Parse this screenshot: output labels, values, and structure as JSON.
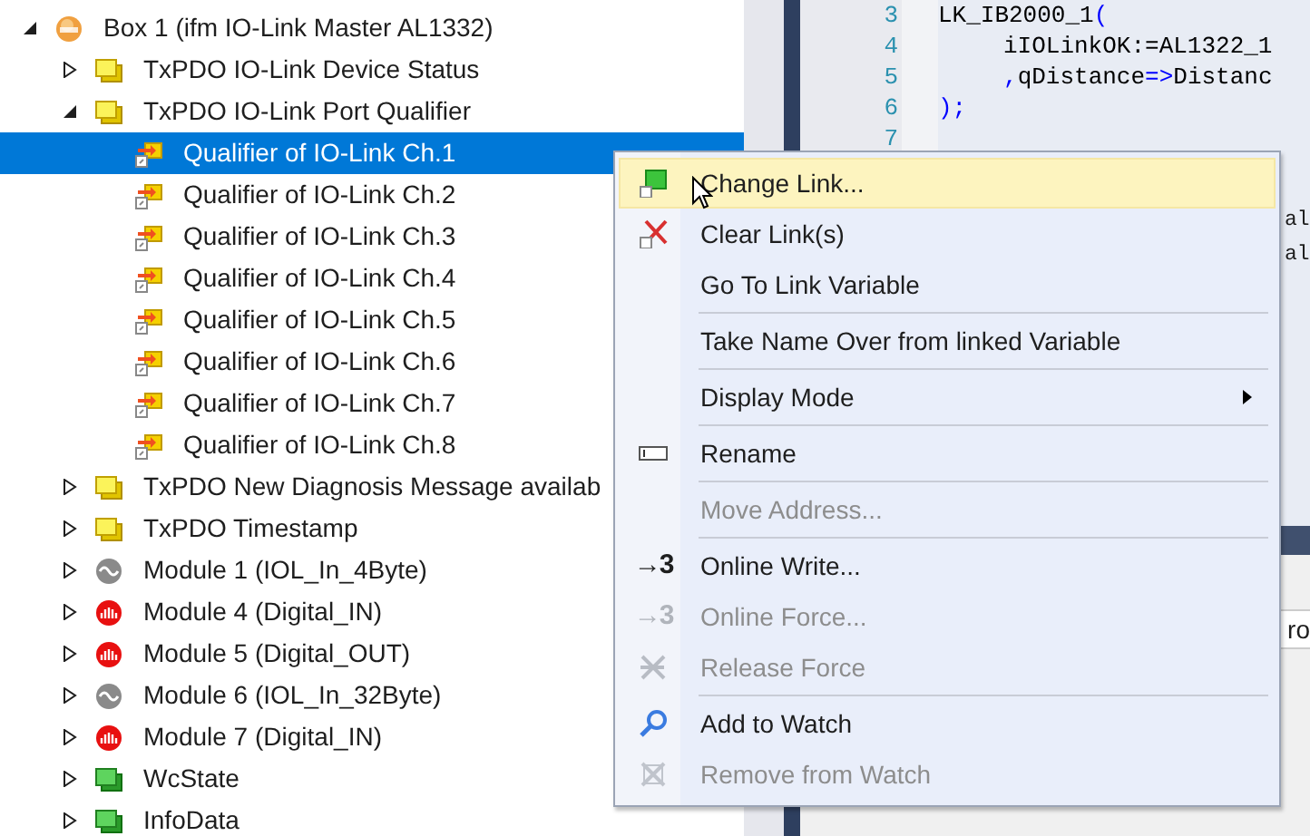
{
  "tree": [
    {
      "label": "Box 1 (ifm IO-Link Master AL1332)",
      "kind": "box",
      "expanded": true,
      "selected": false,
      "children": [
        {
          "label": "TxPDO IO-Link Device Status",
          "kind": "pdo",
          "expanded": false,
          "selected": false
        },
        {
          "label": "TxPDO IO-Link Port Qualifier",
          "kind": "pdo",
          "expanded": true,
          "selected": false,
          "children": [
            {
              "label": "Qualifier of IO-Link Ch.1",
              "kind": "variable",
              "selected": true
            },
            {
              "label": "Qualifier of IO-Link Ch.2",
              "kind": "variable",
              "selected": false
            },
            {
              "label": "Qualifier of IO-Link Ch.3",
              "kind": "variable",
              "selected": false
            },
            {
              "label": "Qualifier of IO-Link Ch.4",
              "kind": "variable",
              "selected": false
            },
            {
              "label": "Qualifier of IO-Link Ch.5",
              "kind": "variable",
              "selected": false
            },
            {
              "label": "Qualifier of IO-Link Ch.6",
              "kind": "variable",
              "selected": false
            },
            {
              "label": "Qualifier of IO-Link Ch.7",
              "kind": "variable",
              "selected": false
            },
            {
              "label": "Qualifier of IO-Link Ch.8",
              "kind": "variable",
              "selected": false
            }
          ]
        },
        {
          "label": "TxPDO New Diagnosis Message availab",
          "kind": "pdo",
          "expanded": false,
          "selected": false
        },
        {
          "label": "TxPDO Timestamp",
          "kind": "pdo",
          "expanded": false,
          "selected": false
        },
        {
          "label": "Module 1 (IOL_In_4Byte)",
          "kind": "module_iol",
          "expanded": false,
          "selected": false
        },
        {
          "label": "Module 4 (Digital_IN)",
          "kind": "module_digital",
          "expanded": false,
          "selected": false
        },
        {
          "label": "Module 5 (Digital_OUT)",
          "kind": "module_digital",
          "expanded": false,
          "selected": false
        },
        {
          "label": "Module 6 (IOL_In_32Byte)",
          "kind": "module_iol",
          "expanded": false,
          "selected": false
        },
        {
          "label": "Module 7 (Digital_IN)",
          "kind": "module_digital",
          "expanded": false,
          "selected": false
        },
        {
          "label": "WcState",
          "kind": "state",
          "expanded": false,
          "selected": false
        },
        {
          "label": "InfoData",
          "kind": "state",
          "expanded": false,
          "selected": false
        }
      ]
    }
  ],
  "editor": {
    "lines": [
      {
        "number": "3",
        "indent": false,
        "tokens": [
          {
            "text": "LK_IB2000_1",
            "kind": "id"
          },
          {
            "text": "(",
            "kind": "op"
          }
        ]
      },
      {
        "number": "4",
        "indent": true,
        "tokens": [
          {
            "text": "iIOLinkOK:=AL1322_1",
            "kind": "id"
          }
        ]
      },
      {
        "number": "5",
        "indent": true,
        "tokens": [
          {
            "text": ",",
            "kind": "op"
          },
          {
            "text": "qDistance",
            "kind": "id"
          },
          {
            "text": "=>",
            "kind": "op"
          },
          {
            "text": "Distanc",
            "kind": "id"
          }
        ]
      },
      {
        "number": "6",
        "indent": false,
        "tokens": [
          {
            "text": ");",
            "kind": "op"
          }
        ]
      },
      {
        "number": "7"
      }
    ],
    "covered_text": [
      "al",
      "al"
    ]
  },
  "bottom_panel": {
    "text": "ro"
  },
  "context_menu": {
    "items": [
      {
        "kind": "item",
        "label": "Change Link...",
        "disabled": false,
        "selected": true,
        "submenu": false
      },
      {
        "kind": "item",
        "label": "Clear Link(s)",
        "disabled": false,
        "selected": false,
        "submenu": false
      },
      {
        "kind": "item",
        "label": "Go To Link Variable",
        "disabled": false,
        "selected": false,
        "submenu": false
      },
      {
        "kind": "separator"
      },
      {
        "kind": "item",
        "label": "Take Name Over from linked Variable",
        "disabled": false,
        "selected": false,
        "submenu": false
      },
      {
        "kind": "separator"
      },
      {
        "kind": "item",
        "label": "Display Mode",
        "disabled": false,
        "selected": false,
        "submenu": true
      },
      {
        "kind": "separator"
      },
      {
        "kind": "item",
        "label": "Rename",
        "disabled": false,
        "selected": false,
        "submenu": false
      },
      {
        "kind": "separator"
      },
      {
        "kind": "item",
        "label": "Move Address...",
        "disabled": true,
        "selected": false,
        "submenu": false
      },
      {
        "kind": "separator"
      },
      {
        "kind": "item",
        "label": "Online Write...",
        "glyph": "→3",
        "disabled": false,
        "selected": false,
        "submenu": false
      },
      {
        "kind": "item",
        "label": "Online Force...",
        "glyph": "→3",
        "disabled": true,
        "selected": false,
        "submenu": false
      },
      {
        "kind": "item",
        "label": "Release Force",
        "disabled": true,
        "selected": false,
        "submenu": false
      },
      {
        "kind": "separator"
      },
      {
        "kind": "item",
        "label": "Add to Watch",
        "disabled": false,
        "selected": false,
        "submenu": false
      },
      {
        "kind": "item",
        "label": "Remove from Watch",
        "disabled": true,
        "selected": false,
        "submenu": false
      }
    ]
  }
}
